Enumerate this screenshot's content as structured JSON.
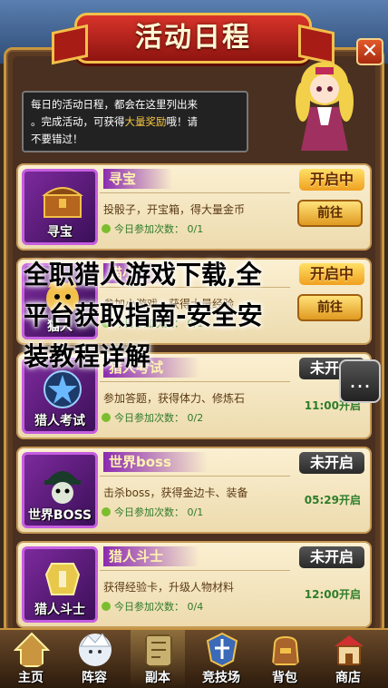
{
  "header": {
    "title": "活动日程",
    "close_label": "✕"
  },
  "description": {
    "line1": "每日的活动日程，都会在这里列出来",
    "line2_pre": "。完成活动，可获得",
    "line2_highlight": "大量奖励",
    "line2_post": "哦！请",
    "line3": "不要错过！"
  },
  "activities": [
    {
      "name": "寻宝",
      "icon_label": "寻宝",
      "icon": "treasure-chest-icon",
      "desc": "投骰子，开宝箱，得大量金币",
      "count": "今日参加次数： 0/1",
      "status": "开启中",
      "action": "前往",
      "time": ""
    },
    {
      "name": "猫小",
      "icon_label": "猫人",
      "icon": "cat-icon",
      "desc": "参加小游戏，获得大量经验",
      "count": "今日参加次数： 0/1",
      "status": "开启中",
      "action": "前往",
      "time": ""
    },
    {
      "name": "猎人考试",
      "icon_label": "猎人考试",
      "icon": "star-emblem-icon",
      "desc": "参加答题，获得体力、修炼石",
      "count": "今日参加次数： 0/2",
      "status": "未开启",
      "action": "",
      "time": "11:00开启"
    },
    {
      "name": "世界boss",
      "icon_label": "世界BOSS",
      "icon": "boss-icon",
      "desc": "击杀boss，获得金边卡、装备",
      "count": "今日参加次数： 0/1",
      "status": "未开启",
      "action": "",
      "time": "05:29开启"
    },
    {
      "name": "猎人斗士",
      "icon_label": "猎人斗士",
      "icon": "armor-icon",
      "desc": "获得经验卡，升级人物材料",
      "count": "今日参加次数： 0/4",
      "status": "未开启",
      "action": "",
      "time": "12:00开启"
    }
  ],
  "overlay": {
    "line1": "全职猎人游戏下载,全",
    "line2": "平台获取指南-安全安",
    "line3": "装教程详解"
  },
  "chat_icon": "…",
  "tabs": [
    {
      "label": "主页",
      "icon": "home-icon"
    },
    {
      "label": "阵容",
      "icon": "lineup-icon"
    },
    {
      "label": "副本",
      "icon": "dungeon-icon"
    },
    {
      "label": "竞技场",
      "icon": "arena-icon"
    },
    {
      "label": "背包",
      "icon": "bag-icon"
    },
    {
      "label": "商店",
      "icon": "shop-icon"
    }
  ],
  "colors": {
    "accent": "#f5c542",
    "banner": "#d8342a",
    "purple": "#8b2ab0"
  }
}
